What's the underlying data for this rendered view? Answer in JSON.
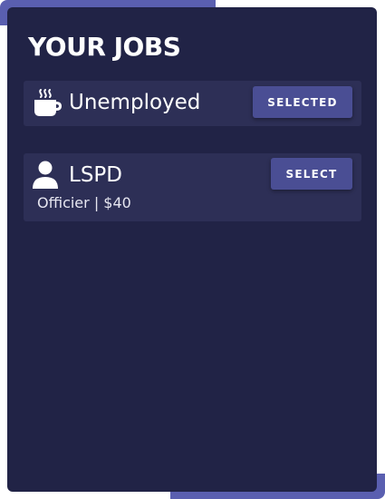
{
  "header": {
    "title": "YOUR JOBS"
  },
  "jobs": [
    {
      "name": "Unemployed",
      "icon": "coffee-icon",
      "subtitle": "",
      "button_label": "SELECTED",
      "selected": true
    },
    {
      "name": "LSPD",
      "icon": "user-icon",
      "subtitle": "Officier | $40",
      "button_label": "SELECT",
      "selected": false
    }
  ],
  "colors": {
    "panel_background": "#212346",
    "card_background": "#2d2f56",
    "button_background": "#4a4e94",
    "accent": "#5a5fb0",
    "text": "#ffffff"
  }
}
